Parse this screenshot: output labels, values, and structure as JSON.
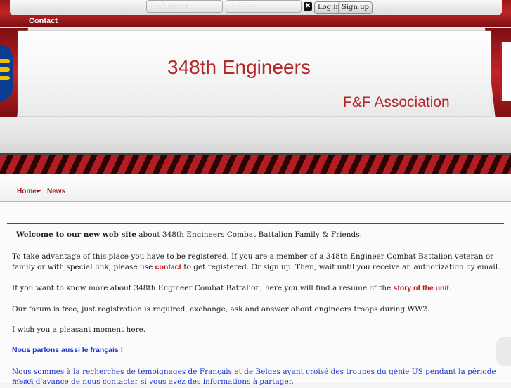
{
  "login": {
    "nickname_placeholder": "Nickname",
    "password_placeholder": "••••••",
    "login_label": "Log in",
    "signup_label": "Sign up"
  },
  "nav": {
    "contact_label": "Contact"
  },
  "header": {
    "title": "348th Engineers",
    "subtitle": "F&F Association"
  },
  "breadcrumb": {
    "home": "Home",
    "separator": "►",
    "current": "News"
  },
  "content": {
    "welcome_bold": "Welcome to our new web site",
    "welcome_rest": " about 348th Engineers Combat Battalion Family & Friends.",
    "register_1": "To take advantage of this place you have to be registered. If you are a member of a 348th Engineer Combat Battalion veteran or family or with special link, please use ",
    "register_link": "contact",
    "register_2": " to get registered. Or sign up. Then, wait until you receive an authorization by email.",
    "story_1": "If you want to know more about 348th Engineer Combat Battalion, here you will find a resume of the ",
    "story_link": "story of the unit",
    "story_2": ".",
    "forum": "Our forum is free, just registration is required, exchange, ask and answer about engineers troops during WW2.",
    "wish": "I wish you a pleasant moment here.",
    "french_heading": "Nous parlons aussi le français !",
    "french_1": "Nous sommes à la recherches de témoignages de Français et de Belges ayant croisé des troupes du génie US pendant la période 39-45,",
    "french_2": "merci d'avance de nous contacter si vous avez des informations à partager."
  },
  "colors": {
    "accent_red": "#b3262a",
    "link_blue": "#1a33c8",
    "link_red": "#c4121b"
  }
}
